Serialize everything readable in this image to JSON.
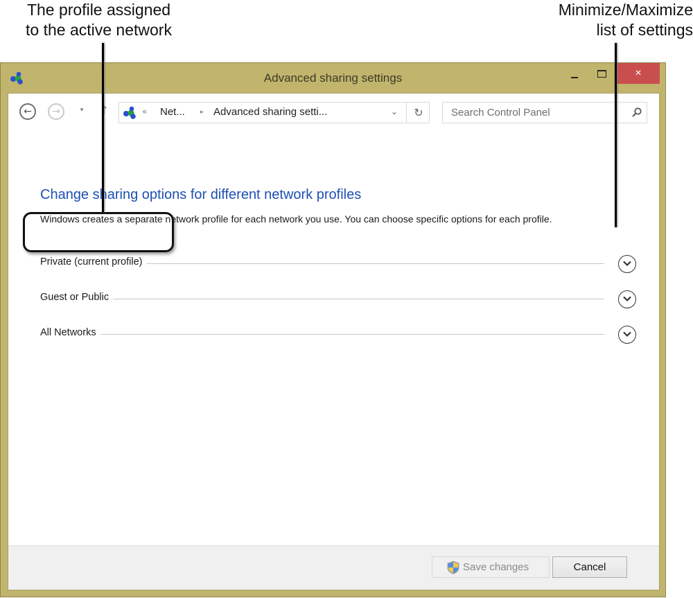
{
  "annotations": {
    "left_callout": [
      "The profile assigned",
      "to the active network"
    ],
    "right_callout": [
      "Minimize/Maximize",
      "list of settings"
    ]
  },
  "window": {
    "title": "Advanced sharing settings",
    "app_icon": "network-sharing-icon",
    "controls": {
      "minimize": "minimize-icon",
      "maximize": "maximize-icon",
      "close": "×"
    }
  },
  "navigation": {
    "back_icon": "←",
    "forward_icon": "→",
    "recent_icon": "▾",
    "up_icon": "↑",
    "address": {
      "overflow": "«",
      "crumbs": [
        "Net...",
        "Advanced sharing setti..."
      ],
      "separator": "▸",
      "dropdown_icon": "⌄",
      "refresh_icon": "↻"
    },
    "search": {
      "placeholder": "Search Control Panel"
    }
  },
  "content": {
    "heading": "Change sharing options for different network profiles",
    "description": "Windows creates a separate network profile for each network you use. You can choose specific options for each profile.",
    "profiles": [
      {
        "label": "Private (current profile)",
        "expanded": false,
        "current": true
      },
      {
        "label": "Guest or Public",
        "expanded": false,
        "current": false
      },
      {
        "label": "All Networks",
        "expanded": false,
        "current": false
      }
    ]
  },
  "footer": {
    "save_label": "Save changes",
    "save_enabled": false,
    "cancel_label": "Cancel"
  },
  "colors": {
    "frame": "#c1b46c",
    "close": "#c94f4f",
    "heading": "#1e4fb4",
    "footer": "#f0f0f0"
  }
}
